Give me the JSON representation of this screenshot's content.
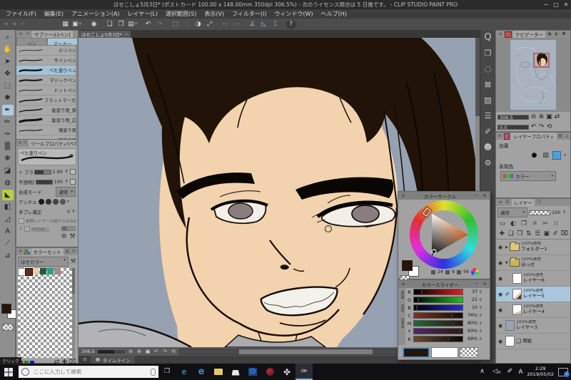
{
  "window": {
    "title": "ほせこしょ5月3日* (ポストカード 100.00 x 148.00mm 350dpi 306.5%)  - 次のライセンス照合は 5 日後です。 - CLIP STUDIO PAINT PRO"
  },
  "menu": {
    "items": [
      "ファイル(F)",
      "編集(E)",
      "アニメーション(A)",
      "レイヤー(L)",
      "選択範囲(S)",
      "表示(V)",
      "フィルター(I)",
      "ウィンドウ(W)",
      "ヘルプ(H)"
    ]
  },
  "document": {
    "tab": "ほせこしょ5月3日*",
    "close": "×"
  },
  "subtool": {
    "title": "サブツール[ペン]",
    "tab_pen": "ペン",
    "tab_marker": "マーカー",
    "brushes": [
      "ミリペン",
      "サインペン",
      "べた塗りペン",
      "マジックペン",
      "ドットペン",
      "フラットマーカー",
      "髪塗り用_狭",
      "髪塗り用_広",
      "薄塗り用",
      "肌塗り用"
    ]
  },
  "toolprop": {
    "title": "ツールプロパティ[べた塗り...]",
    "brush_name": "べた塗りペン",
    "brush_size_label": "ブラシサイズ",
    "brush_size": "1.95",
    "opacity_label": "不透明度",
    "opacity": "100",
    "blend_label": "合成モード",
    "blend_value": "通常",
    "aa_label": "アンチエイリアス",
    "stab_label": "手ブレ補正",
    "stab_value": "0",
    "ref_label": "参照レイヤーの縁からはみ出さない",
    "gap_label": "隙間閉じ"
  },
  "colorset": {
    "title": "カラーセット",
    "set_name": "ほせカラー",
    "swatches": [
      "#ffffff",
      "#5e2b20",
      "#f2cba6",
      "#1d5c40",
      "#2aa183",
      "#a58a7d"
    ]
  },
  "colorcircle": {
    "title": "カラーサークル",
    "h": "24",
    "s": "9",
    "v": "56"
  },
  "colorslider": {
    "title": "カラースライダー",
    "tabs": [
      "RGB",
      "HSV",
      "CMYK"
    ],
    "rows": [
      {
        "label": "R",
        "value": "37"
      },
      {
        "label": "G",
        "value": "21"
      },
      {
        "label": "B",
        "value": "10"
      },
      {
        "label": "C",
        "value": "76%"
      },
      {
        "label": "M",
        "value": "80%"
      },
      {
        "label": "Y",
        "value": "93%"
      },
      {
        "label": "K",
        "value": "69%"
      }
    ],
    "foreground": "#251509",
    "background": "#ffffff"
  },
  "navigator": {
    "title": "ナビゲーター",
    "zoom": "306.5",
    "rotation": "0.0"
  },
  "layerprop": {
    "title": "レイヤープロパティ",
    "effect_label": "効果",
    "expression_label": "表現色",
    "expression_value": "カラー"
  },
  "layers": {
    "title": "レイヤー",
    "blend_mode": "通常",
    "opacity": "100",
    "items": [
      {
        "info": "100%通常",
        "name": "フォルダー1"
      },
      {
        "info": "100%通常",
        "name": "ほっせ"
      },
      {
        "info": "100%通常",
        "name": "レイヤー6"
      },
      {
        "info": "100%通常",
        "name": "レイヤー5"
      },
      {
        "info": "100%通常",
        "name": "レイヤー4"
      },
      {
        "info": "100%通常",
        "name": "レイヤー3"
      },
      {
        "info": "",
        "name": "用紙"
      }
    ]
  },
  "canvasbar": {
    "zoom": "306.5"
  },
  "timeline": {
    "title": "タイムライン"
  },
  "taskbar": {
    "search_placeholder": "ここに入力して検索",
    "time": "2:29",
    "date": "2019/05/02",
    "ime": "A",
    "badge": "1",
    "tooltip": "クリック"
  },
  "icon_map": {
    "win-minimize": "─",
    "win-maximize": "□",
    "win-close": "✕",
    "collapse-double": "«",
    "collapse-single": "‹",
    "grid": "▦",
    "screen": "▣",
    "caret-down": "▾",
    "eye": "◉",
    "new-file": "❏",
    "open-file": "❐",
    "save": "▤",
    "undo": "↶",
    "redo": "↷",
    "select-new": "⬚",
    "select-sub": "◌",
    "select-inv": "◑",
    "transform": "⤢",
    "dim-a": "▭",
    "dim-b": "▭",
    "snap-ruler": "∠",
    "snap-special": "◺",
    "snap-guide": "⌶",
    "help": "?",
    "zoom-tool": "⌕",
    "hand-tool": "✋",
    "operate-tool": "➤",
    "movelayer-tool": "✥",
    "marquee-tool": "⬚",
    "wand-tool": "✱",
    "pen-tool": "✒",
    "pencil-tool": "✏",
    "brush-tool": "✑",
    "airbrush-tool": "▒",
    "deco-tool": "❋",
    "eraser-tool": "◪",
    "blend-tool": "◍",
    "fill-tool": "◣",
    "gradient-tool": "◧",
    "figure-tool": "◿",
    "text-tool": "A",
    "linefix-tool": "⟋",
    "ruler-tool": "⊿",
    "panel-menu": "≡",
    "mini-a": "≋",
    "mini-b": "✎",
    "pen-nib": "✒",
    "stepper": "⇕",
    "gear": "⚙",
    "wrench": "⚒",
    "plus": "＋",
    "swatch-tab-a": "▥",
    "swatch-tab-b": "↻",
    "swap": "⇄",
    "add": "✚",
    "trash": "⌧",
    "minus-zoom": "⊖",
    "plus-zoom": "⊕",
    "fit": "▣",
    "rot-left": "↶",
    "rot-right": "↷",
    "reset": "⟲",
    "flip": "⇄",
    "tri-right": "▶",
    "tri-down": "▼",
    "edit-pen": "✐",
    "paper": "❏",
    "q": "Q",
    "strip-folder": "❐",
    "strip-circle": "◌",
    "strip-x": "⊠",
    "strip-checker": "▨",
    "strip-lines": "☰",
    "strip-pen": "✐",
    "strip-person": "☻",
    "strip-gear": "⚙",
    "nav-tab-b": "▣",
    "nav-tab-c": "◐",
    "nav-tab-d": "⚉",
    "lp-tab-b": "▧",
    "lp-tab-c": "△",
    "effect-border": "●",
    "effect-tone": "▨",
    "layers-tab-b": "❐",
    "lr-a": "▭",
    "lr-b": "◐",
    "lr-c": "❐",
    "lr-d": "☼",
    "lr-e": "✂",
    "lr-f": "⊠",
    "lr2-a": "✚",
    "lr2-b": "❏",
    "lr2-c": "❐",
    "lr2-d": "⇅",
    "lr2-e": "☰",
    "lr2-f": "▣",
    "lr2-g": "✐",
    "lr2-h": "⌧",
    "chev-up": "∧",
    "speaker-mute": "◁",
    "mute-x": "×",
    "pen-tray": "✐",
    "taskview": "❒",
    "ie": "e",
    "edge": "e",
    "outlook": "O",
    "clover": "✤",
    "csp": "✑",
    "search-circle": "○"
  }
}
